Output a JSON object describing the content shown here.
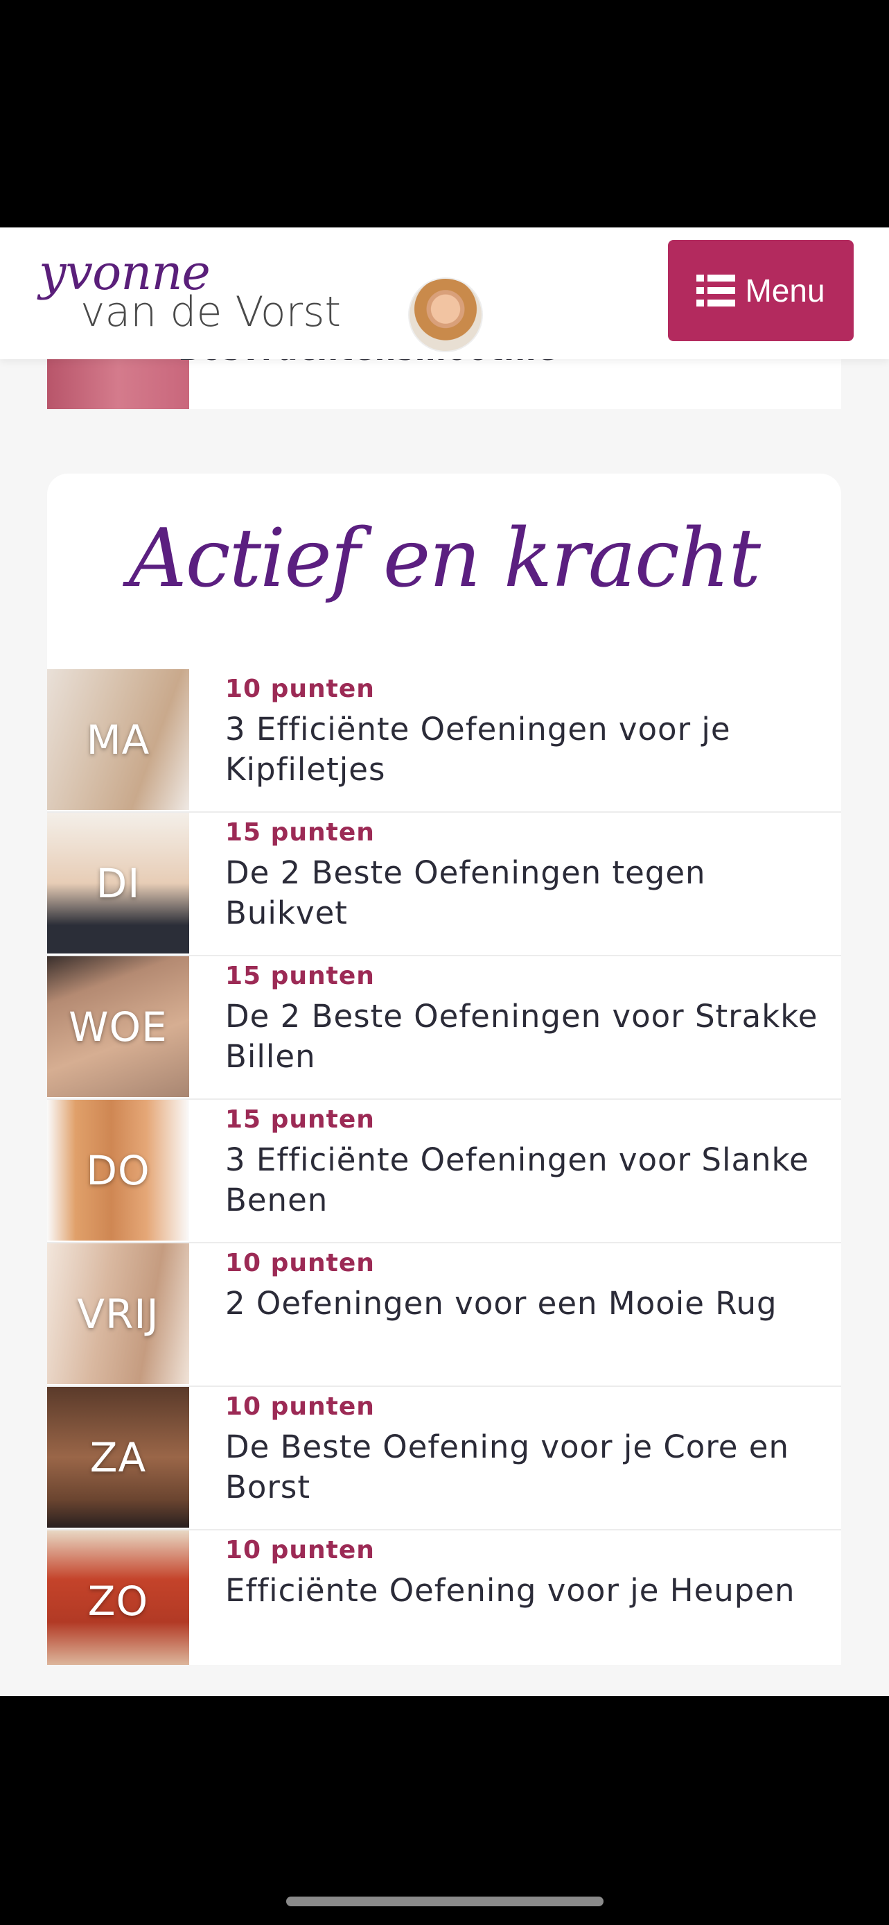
{
  "header": {
    "logo_script": "yvonne",
    "logo_plain": "van de Vorst",
    "menu_label": "Menu"
  },
  "prev_item": {
    "title": "Bosvruchtensmoothie"
  },
  "section": {
    "title": "Actief en kracht",
    "items": [
      {
        "day": "MA",
        "points": "10 punten",
        "title": "3 Efficiënte Oefeningen voor je Kipfiletjes"
      },
      {
        "day": "DI",
        "points": "15 punten",
        "title": "De 2 Beste Oefeningen tegen Buikvet"
      },
      {
        "day": "WOE",
        "points": "15 punten",
        "title": "De 2 Beste Oefeningen voor Strakke Billen"
      },
      {
        "day": "DO",
        "points": "15 punten",
        "title": "3 Efficiënte Oefeningen voor Slanke Benen"
      },
      {
        "day": "VRIJ",
        "points": "10 punten",
        "title": "2 Oefeningen voor een Mooie Rug"
      },
      {
        "day": "ZA",
        "points": "10 punten",
        "title": "De Beste Oefening voor je Core en Borst"
      },
      {
        "day": "ZO",
        "points": "10 punten",
        "title": "Efficiënte Oefening voor je Heupen"
      }
    ]
  },
  "colors": {
    "accent": "#b32a5e",
    "points": "#9c2a55",
    "title_script": "#5b1f80"
  }
}
